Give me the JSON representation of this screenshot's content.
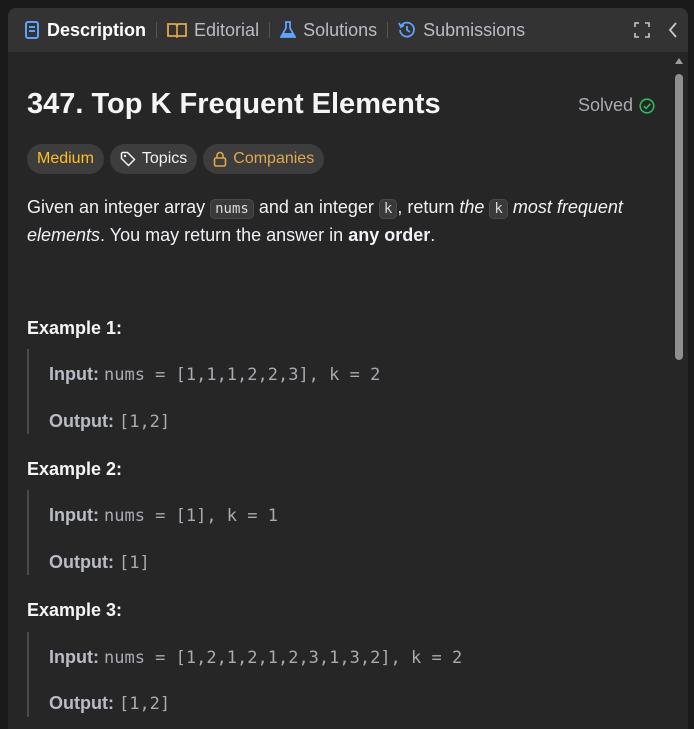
{
  "tabs": [
    {
      "label": "Description",
      "icon": "description-icon",
      "active": true
    },
    {
      "label": "Editorial",
      "icon": "book-icon"
    },
    {
      "label": "Solutions",
      "icon": "flask-icon"
    },
    {
      "label": "Submissions",
      "icon": "history-icon"
    }
  ],
  "problem": {
    "title": "347. Top K Frequent Elements",
    "status": "Solved"
  },
  "chips": {
    "difficulty": "Medium",
    "topics": "Topics",
    "companies": "Companies"
  },
  "description": {
    "p1": "Given an integer array ",
    "code1": "nums",
    "p2": " and an integer ",
    "code2": "k",
    "p3": ", return ",
    "em1": "the ",
    "code3": "k",
    "em2": " most frequent elements",
    "p4": ". You may return the answer in ",
    "strong1": "any order",
    "p5": "."
  },
  "examples": [
    {
      "title": "Example 1:",
      "input_label": "Input:",
      "input": "nums = [1,1,1,2,2,3], k = 2",
      "output_label": "Output:",
      "output": "[1,2]"
    },
    {
      "title": "Example 2:",
      "input_label": "Input:",
      "input": "nums = [1], k = 1",
      "output_label": "Output:",
      "output": "[1]"
    },
    {
      "title": "Example 3:",
      "input_label": "Input:",
      "input": "nums = [1,2,1,2,1,2,3,1,3,2], k = 2",
      "output_label": "Output:",
      "output": "[1,2]"
    }
  ],
  "colors": {
    "accent_blue": "#5ea1ff",
    "medium": "#ffc01e",
    "solved": "#2cbb5d",
    "companies": "#e0a84a"
  }
}
